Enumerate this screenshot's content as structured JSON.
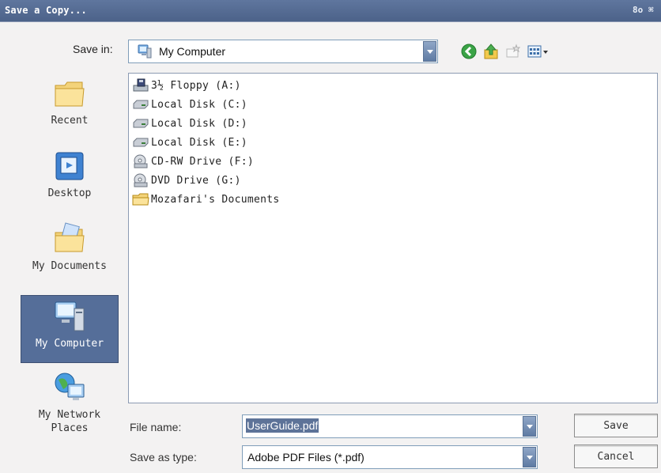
{
  "window": {
    "title": "Save a Copy...",
    "btn_a": "8o",
    "btn_b": "⌘"
  },
  "save_in": {
    "label": "Save in:",
    "value": "My Computer"
  },
  "toolbar": {
    "back_icon": "back-icon",
    "up_icon": "up-folder-icon",
    "new_folder_icon": "new-folder-icon",
    "views_icon": "views-menu-icon"
  },
  "places": [
    {
      "label": "Recent",
      "icon": "recent-folder-icon"
    },
    {
      "label": "Desktop",
      "icon": "desktop-icon"
    },
    {
      "label": "My Documents",
      "icon": "my-documents-icon"
    },
    {
      "label": "My Computer",
      "icon": "my-computer-icon",
      "selected": true
    },
    {
      "label_line1": "My Network",
      "label_line2": "Places",
      "icon": "network-places-icon"
    }
  ],
  "files": [
    {
      "name": "3½ Floppy (A:)",
      "icon": "floppy-drive-icon"
    },
    {
      "name": "Local Disk (C:)",
      "icon": "hard-disk-icon"
    },
    {
      "name": "Local Disk (D:)",
      "icon": "hard-disk-icon"
    },
    {
      "name": "Local Disk (E:)",
      "icon": "hard-disk-icon"
    },
    {
      "name": "CD-RW Drive (F:)",
      "icon": "cd-drive-icon"
    },
    {
      "name": "DVD Drive (G:)",
      "icon": "dvd-drive-icon"
    },
    {
      "name": "Mozafari's Documents",
      "icon": "folder-icon"
    }
  ],
  "file_name": {
    "label": "File name:",
    "value": "UserGuide.pdf"
  },
  "save_as_type": {
    "label": "Save as type:",
    "value": "Adobe PDF Files (*.pdf)"
  },
  "buttons": {
    "save": "Save",
    "cancel": "Cancel"
  },
  "colors": {
    "titlebar": "#4c6289",
    "selection": "#556e99",
    "accent_green": "#3aa346"
  }
}
